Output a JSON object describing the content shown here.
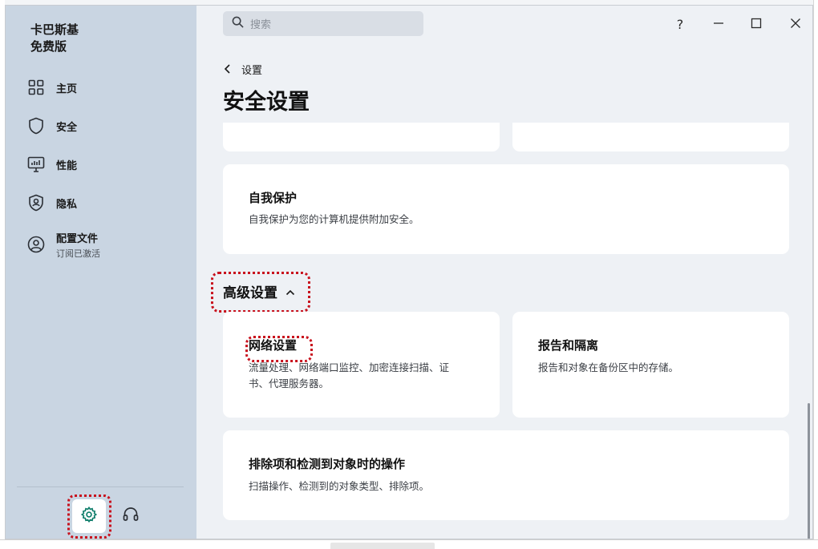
{
  "app": {
    "brand_line1": "卡巴斯基",
    "brand_line2": "免费版"
  },
  "sidebar": {
    "items": [
      {
        "label": "主页",
        "icon": "grid-icon"
      },
      {
        "label": "安全",
        "icon": "shield-icon"
      },
      {
        "label": "性能",
        "icon": "monitor-icon"
      },
      {
        "label": "隐私",
        "icon": "privacy-shield-icon"
      },
      {
        "label": "配置文件",
        "sublabel": "订阅已激活",
        "icon": "user-circle-icon"
      }
    ],
    "settings_icon": "gear-icon",
    "support_icon": "headset-icon"
  },
  "topbar": {
    "search_placeholder": "搜索",
    "help": "?"
  },
  "header": {
    "back_label": "设置",
    "title": "安全设置"
  },
  "cards": {
    "self_protection": {
      "title": "自我保护",
      "desc": "自我保护为您的计算机提供附加安全。"
    },
    "network": {
      "title": "网络设置",
      "desc_line1": "流量处理、网络端口监控、加密连接扫描、证",
      "desc_line2": "书、代理服务器。"
    },
    "reports": {
      "title": "报告和隔离",
      "desc": "报告和对象在备份区中的存储。"
    },
    "exclusions": {
      "title": "排除项和检测到对象时的操作",
      "desc": "扫描操作、检测到的对象类型、排除项。"
    }
  },
  "advanced": {
    "label": "高级设置",
    "expanded": true
  },
  "colors": {
    "sidebar_bg": "#c9d5e2",
    "content_bg": "#eef1f5",
    "accent_green": "#0e7d6a",
    "highlight_red": "#c8111d"
  }
}
